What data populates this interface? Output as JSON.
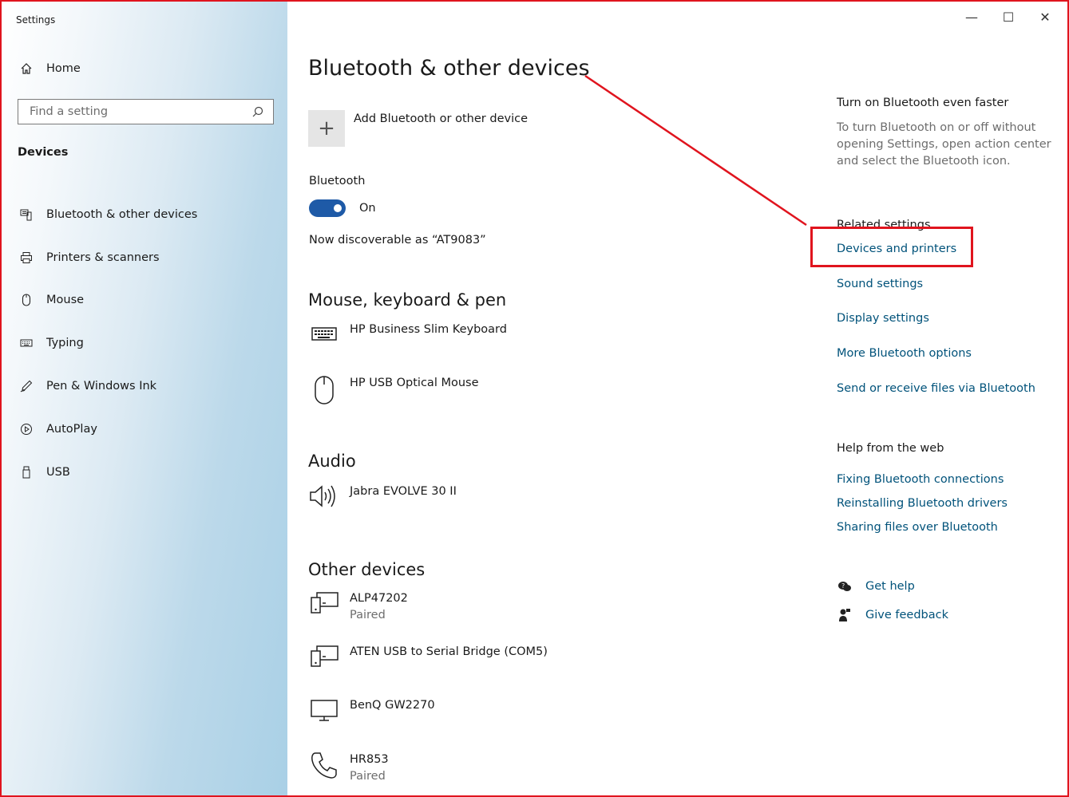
{
  "window": {
    "title": "Settings",
    "controls": {
      "minimize": "—",
      "maximize": "☐",
      "close": "✕"
    }
  },
  "sidebar": {
    "home_label": "Home",
    "search_placeholder": "Find a setting",
    "section_label": "Devices",
    "items": [
      {
        "label": "Bluetooth & other devices",
        "icon": "bluetooth-devices-icon"
      },
      {
        "label": "Printers & scanners",
        "icon": "printer-icon"
      },
      {
        "label": "Mouse",
        "icon": "mouse-icon"
      },
      {
        "label": "Typing",
        "icon": "keyboard-icon"
      },
      {
        "label": "Pen & Windows Ink",
        "icon": "pen-icon"
      },
      {
        "label": "AutoPlay",
        "icon": "autoplay-icon"
      },
      {
        "label": "USB",
        "icon": "usb-icon"
      }
    ]
  },
  "main": {
    "title": "Bluetooth & other devices",
    "add_device_label": "Add Bluetooth or other device",
    "bluetooth_label": "Bluetooth",
    "toggle_state": "On",
    "discoverable_text": "Now discoverable as “AT9083”",
    "sections": {
      "mouse_keyboard": {
        "title": "Mouse, keyboard & pen",
        "devices": [
          {
            "name": "HP Business Slim Keyboard",
            "status": "",
            "icon": "keyboard-icon"
          },
          {
            "name": "HP USB Optical Mouse",
            "status": "",
            "icon": "mouse-icon"
          }
        ]
      },
      "audio": {
        "title": "Audio",
        "devices": [
          {
            "name": "Jabra EVOLVE 30 II",
            "status": "",
            "icon": "speaker-icon"
          }
        ]
      },
      "other": {
        "title": "Other devices",
        "devices": [
          {
            "name": "ALP47202",
            "status": "Paired",
            "icon": "device-icon"
          },
          {
            "name": "ATEN USB to Serial Bridge (COM5)",
            "status": "",
            "icon": "device-icon"
          },
          {
            "name": "BenQ GW2270",
            "status": "",
            "icon": "monitor-icon"
          },
          {
            "name": "HR853",
            "status": "Paired",
            "icon": "phone-icon"
          }
        ]
      }
    }
  },
  "right": {
    "faster_title": "Turn on Bluetooth even faster",
    "faster_desc": "To turn Bluetooth on or off without opening Settings, open action center and select the Bluetooth icon.",
    "related_title": "Related settings",
    "related_links": [
      "Devices and printers",
      "Sound settings",
      "Display settings",
      "More Bluetooth options",
      "Send or receive files via Bluetooth"
    ],
    "help_title": "Help from the web",
    "help_links": [
      "Fixing Bluetooth connections",
      "Reinstalling Bluetooth drivers",
      "Sharing files over Bluetooth"
    ],
    "get_help": "Get help",
    "give_feedback": "Give feedback"
  },
  "annotation": {
    "color": "#e0141e"
  }
}
